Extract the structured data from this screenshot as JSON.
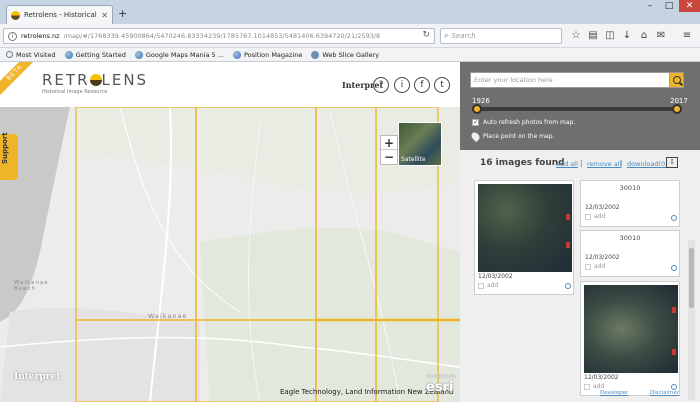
{
  "browser": {
    "tab_title": "Retrolens - Historical Image",
    "url_host": "retrolens.nz",
    "url_path": "/map/#/1768339.45900864/5470246.83334239/1785767.1014853/5481406.6394720/21/2593/8",
    "search_placeholder": "Search",
    "bookmarks": [
      "Most Visited",
      "Getting Started",
      "Google Maps Mania 5 ...",
      "Position Magazine",
      "Web Slice Gallery"
    ]
  },
  "header": {
    "beta": "BETA",
    "logo": "RETR",
    "logo_tail": "LENS",
    "tagline": "Historical Image Resource",
    "interpret": "Interpret",
    "help_icon": "?",
    "info_icon": "i",
    "facebook_icon": "f",
    "twitter_icon": "t"
  },
  "map": {
    "support_tab": "Support",
    "zoom_in": "+",
    "zoom_out": "−",
    "satellite_label": "Satellite",
    "places": [
      "Waikanae Beach",
      "Waikanae"
    ],
    "attribution": "Eagle Technology, Land Information New Zealand",
    "esri_small": "POWERED BY",
    "esri": "esri",
    "interpret_watermark": "Interpret"
  },
  "panel": {
    "location_placeholder": "Enter your location here",
    "year_start": "1926",
    "year_end": "2017",
    "slider_range": [
      0,
      1
    ],
    "auto_refresh_label": "Auto refresh photos from map.",
    "auto_refresh_checked": "✓",
    "place_point_label": "Place point on the map.",
    "count_label": "16 images found",
    "add_all": "add all",
    "remove_all": "remove all",
    "download": "download(0)",
    "sep": "|",
    "results": [
      {
        "id": "",
        "date": "12/03/2002",
        "add": "add"
      },
      {
        "id": "30010",
        "date": "12/03/2002",
        "add": "add"
      },
      {
        "id": "30010",
        "date": "12/03/2002",
        "add": "add"
      },
      {
        "id": "",
        "date": "12/03/2002",
        "add": "add"
      }
    ],
    "footer_left": "Developer",
    "footer_right": "Disclaimer"
  },
  "colors": {
    "accent": "#f0b429",
    "panel_header": "#6f6f6f",
    "link": "#4a8ac0"
  }
}
